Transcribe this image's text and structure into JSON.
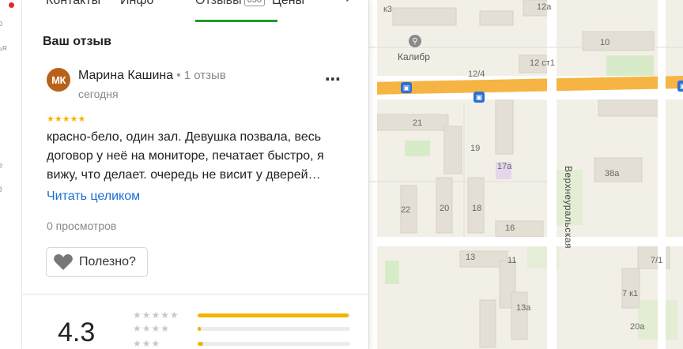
{
  "rail": {
    "fragments": [
      "р",
      "ья",
      "е",
      "ё"
    ]
  },
  "tabs": [
    {
      "label": "Контакты"
    },
    {
      "label": "Инфо"
    },
    {
      "label": "Отзывы",
      "badge": "658"
    },
    {
      "label": "Цены"
    }
  ],
  "review_section": {
    "title": "Ваш отзыв",
    "author": {
      "initials": "МК",
      "name": "Марина Кашина",
      "separator": "•",
      "review_count": "1 отзыв",
      "date": "сегодня"
    },
    "rating": 5,
    "stars": "★★★★★",
    "text_lines": [
      "красно-бело, один зал. Девушка позвала, весь",
      "договор у неё на мониторе, печатает быстро, я",
      "вижу, что делает. очередь не висит у дверей…"
    ],
    "read_more": "Читать целиком",
    "views": "0 просмотров",
    "useful_button": "Полезно?",
    "more_menu": "⋯"
  },
  "summary": {
    "average": "4.3",
    "distribution": [
      {
        "stars": "★★★★★",
        "fraction": 0.99
      },
      {
        "stars": "★★★★",
        "fraction": 0.02
      },
      {
        "stars": "★★★",
        "fraction": 0.035
      }
    ]
  },
  "map": {
    "labels": [
      "к3",
      "12а",
      "10",
      "12 ст1",
      "12/4",
      "21",
      "19",
      "17а",
      "38а",
      "22",
      "20",
      "18",
      "16",
      "13",
      "11",
      "7/1",
      "7 к1",
      "13а",
      "20а"
    ],
    "poi": "Калибр",
    "street": "Верхнеуральская"
  },
  "colors": {
    "accent_green": "#1f9c2b",
    "link_blue": "#1a6bd6",
    "star_yellow": "#f5b400",
    "avatar_bg": "#b8611a",
    "road_orange": "#f5b443"
  }
}
